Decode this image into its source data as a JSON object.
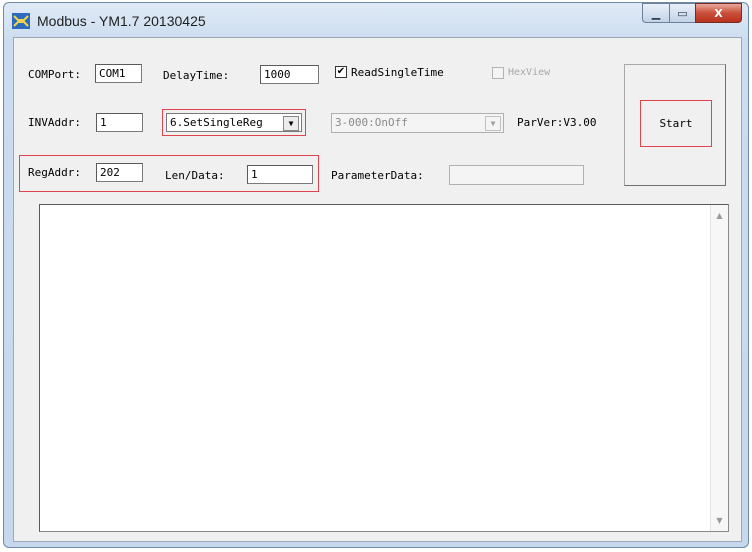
{
  "window": {
    "title": "Modbus - YM1.7 20130425",
    "minimize_glyph": "▁",
    "maximize_glyph": "▭",
    "close_glyph": "X"
  },
  "labels": {
    "comport": "COMPort:",
    "delaytime": "DelayTime:",
    "inv_addr": "INVAddr:",
    "reg_addr": "RegAddr:",
    "len_data": "Len/Data:",
    "parameter_data": "ParameterData:",
    "par_ver": "ParVer:V3.00"
  },
  "fields": {
    "comport": "COM1",
    "delaytime": "1000",
    "inv_addr": "1",
    "reg_addr": "202",
    "len_data": "1",
    "parameter_data": ""
  },
  "checkboxes": {
    "read_single_time": {
      "label": "ReadSingleTime",
      "checked": true,
      "mark": "✔"
    },
    "hex_view": {
      "label": "HexView",
      "checked": false,
      "enabled": false
    }
  },
  "combos": {
    "function": {
      "selected": "6.SetSingleReg"
    },
    "parameter": {
      "selected": "3-000:OnOff",
      "enabled": false
    }
  },
  "buttons": {
    "start": "Start"
  },
  "icons": {
    "app": "modbus-app-icon",
    "combo_arrow": "▼",
    "scroll_up": "▲",
    "scroll_down": "▼"
  },
  "colors": {
    "highlight": "#e0454f",
    "close_button": "#c9503a",
    "title_bar": "#cbdcef"
  }
}
